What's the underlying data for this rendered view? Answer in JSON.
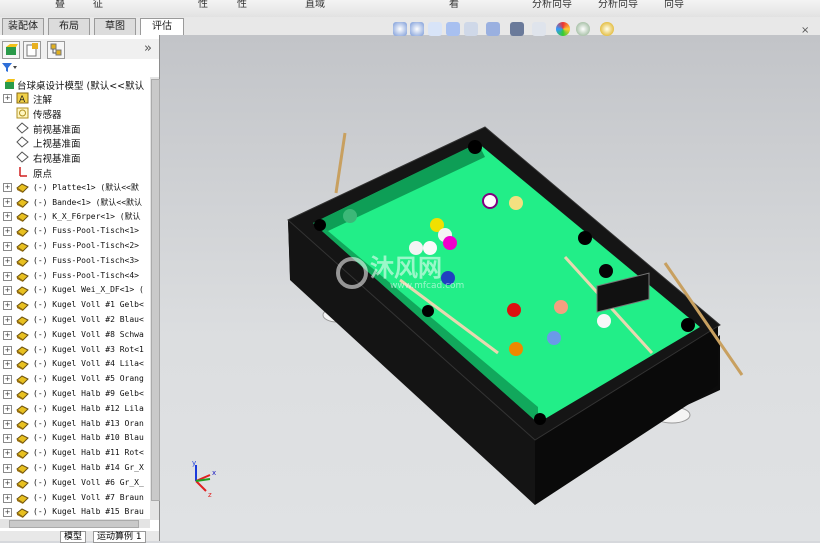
{
  "top_toolbar": {
    "labels": [
      "叠",
      "征",
      "性",
      "性",
      "直域",
      "看",
      "分析向导",
      "分析向导",
      "向导"
    ]
  },
  "tabs": [
    {
      "label": "装配体",
      "active": false
    },
    {
      "label": "布局",
      "active": false
    },
    {
      "label": "草图",
      "active": false
    },
    {
      "label": "评估",
      "active": true
    }
  ],
  "panel": {
    "expand_label": "»",
    "root_label": "台球桌设计模型  (默认<<默认",
    "items": [
      {
        "label": "注解",
        "icon": "annotation-icon",
        "expandable": true
      },
      {
        "label": "传感器",
        "icon": "sensor-icon",
        "expandable": false
      },
      {
        "label": "前视基准面",
        "icon": "plane-icon",
        "expandable": false
      },
      {
        "label": "上视基准面",
        "icon": "plane-icon",
        "expandable": false
      },
      {
        "label": "右视基准面",
        "icon": "plane-icon",
        "expandable": false
      },
      {
        "label": "原点",
        "icon": "origin-icon",
        "expandable": false
      },
      {
        "label": "(-) Platte<1> (默认<<默",
        "icon": "part-icon",
        "expandable": true
      },
      {
        "label": "(-) Bande<1> (默认<<默认",
        "icon": "part-icon",
        "expandable": true
      },
      {
        "label": "(-) K_X_F6rper<1> (默认",
        "icon": "part-icon",
        "expandable": true
      },
      {
        "label": "(-) Fuss-Pool-Tisch<1>",
        "icon": "part-icon",
        "expandable": true
      },
      {
        "label": "(-) Fuss-Pool-Tisch<2>",
        "icon": "part-icon",
        "expandable": true
      },
      {
        "label": "(-) Fuss-Pool-Tisch<3>",
        "icon": "part-icon",
        "expandable": true
      },
      {
        "label": "(-) Fuss-Pool-Tisch<4>",
        "icon": "part-icon",
        "expandable": true
      },
      {
        "label": "(-) Kugel Wei_X_DF<1> (",
        "icon": "part-icon",
        "expandable": true
      },
      {
        "label": "(-) Kugel Voll #1 Gelb<",
        "icon": "part-icon",
        "expandable": true
      },
      {
        "label": "(-) Kugel Voll #2 Blau<",
        "icon": "part-icon",
        "expandable": true
      },
      {
        "label": "(-) Kugel Voll #8 Schwa",
        "icon": "part-icon",
        "expandable": true
      },
      {
        "label": "(-) Kugel Voll #3 Rot<1",
        "icon": "part-icon",
        "expandable": true
      },
      {
        "label": "(-) Kugel Voll #4 Lila<",
        "icon": "part-icon",
        "expandable": true
      },
      {
        "label": "(-) Kugel Voll #5 Orang",
        "icon": "part-icon",
        "expandable": true
      },
      {
        "label": "(-) Kugel Halb #9 Gelb<",
        "icon": "part-icon",
        "expandable": true
      },
      {
        "label": "(-) Kugel Halb #12 Lila",
        "icon": "part-icon",
        "expandable": true
      },
      {
        "label": "(-) Kugel Halb #13 Oran",
        "icon": "part-icon",
        "expandable": true
      },
      {
        "label": "(-) Kugel Halb #10 Blau",
        "icon": "part-icon",
        "expandable": true
      },
      {
        "label": "(-) Kugel Halb #11 Rot<",
        "icon": "part-icon",
        "expandable": true
      },
      {
        "label": "(-) Kugel Halb #14 Gr_X",
        "icon": "part-icon",
        "expandable": true
      },
      {
        "label": "(-) Kugel Voll #6 Gr_X_",
        "icon": "part-icon",
        "expandable": true
      },
      {
        "label": "(-) Kugel Voll #7 Braun",
        "icon": "part-icon",
        "expandable": true
      },
      {
        "label": "(-) Kugel Halb #15 Brau",
        "icon": "part-icon",
        "expandable": true
      }
    ],
    "bottom_tabs": [
      "模型",
      "运动算例 1"
    ]
  },
  "viewport": {
    "close_label": "×",
    "watermark": {
      "title": "沐风网",
      "url": "www.mfcad.com"
    },
    "triad": {
      "x": "x",
      "y": "y",
      "z": "z"
    },
    "colors": {
      "felt": "#22ee88",
      "felt_dark": "#0a8a4a",
      "body": "#111111",
      "background": "#d3d5d8"
    }
  }
}
